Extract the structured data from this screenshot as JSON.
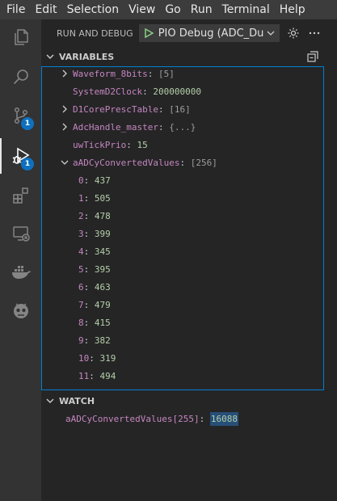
{
  "menu": [
    "File",
    "Edit",
    "Selection",
    "View",
    "Go",
    "Run",
    "Terminal",
    "Help"
  ],
  "activity_bar": [
    {
      "icon": "explorer-icon"
    },
    {
      "icon": "search-icon"
    },
    {
      "icon": "source-control-icon",
      "badge": "1"
    },
    {
      "icon": "run-debug-icon",
      "badge": "1",
      "active": true
    },
    {
      "icon": "extensions-icon"
    },
    {
      "icon": "remote-explorer-icon"
    },
    {
      "icon": "docker-icon"
    },
    {
      "icon": "platformio-icon"
    }
  ],
  "run_panel": {
    "title": "RUN AND DEBUG",
    "config": "PIO Debug (ADC_Dua"
  },
  "variables": {
    "title": "VARIABLES",
    "items": [
      {
        "name": "Waveform_8bits",
        "value": "[5]",
        "expandable": true
      },
      {
        "name": "SystemD2Clock",
        "value": "200000000",
        "expandable": false
      },
      {
        "name": "D1CorePrescTable",
        "value": "[16]",
        "expandable": true
      },
      {
        "name": "AdcHandle_master",
        "value": "{...}",
        "expandable": true
      },
      {
        "name": "uwTickPrio",
        "value": "15",
        "expandable": false
      },
      {
        "name": "aADCyConvertedValues",
        "value": "[256]",
        "expandable": true,
        "expanded": true
      }
    ],
    "array_items": [
      {
        "index": "0",
        "value": "437"
      },
      {
        "index": "1",
        "value": "505"
      },
      {
        "index": "2",
        "value": "478"
      },
      {
        "index": "3",
        "value": "399"
      },
      {
        "index": "4",
        "value": "345"
      },
      {
        "index": "5",
        "value": "395"
      },
      {
        "index": "6",
        "value": "463"
      },
      {
        "index": "7",
        "value": "479"
      },
      {
        "index": "8",
        "value": "415"
      },
      {
        "index": "9",
        "value": "382"
      },
      {
        "index": "10",
        "value": "319"
      },
      {
        "index": "11",
        "value": "494"
      }
    ]
  },
  "watch": {
    "title": "WATCH",
    "expression": "aADCyConvertedValues[255]",
    "value": "16088"
  }
}
